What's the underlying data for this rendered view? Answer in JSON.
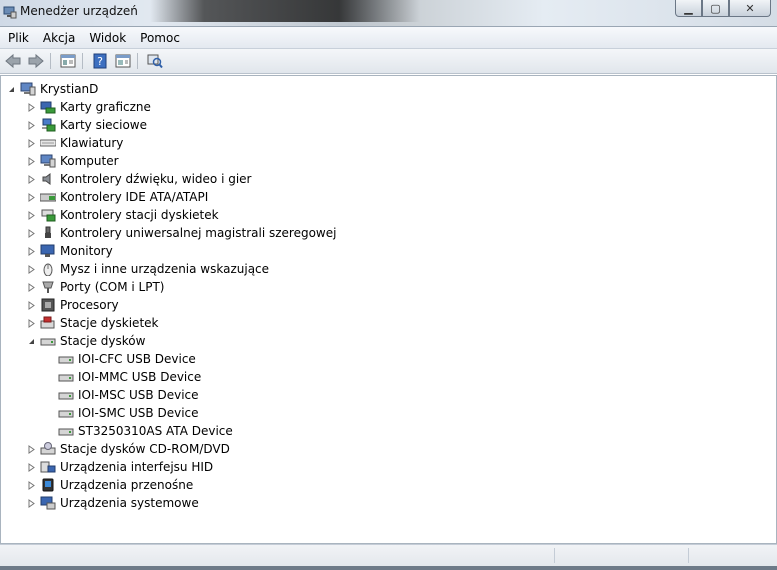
{
  "window": {
    "title": "Menedżer urządzeń"
  },
  "menu": [
    {
      "label": "Plik"
    },
    {
      "label": "Akcja"
    },
    {
      "label": "Widok"
    },
    {
      "label": "Pomoc"
    }
  ],
  "toolbar": {
    "buttons": [
      "back-arrow-icon",
      "forward-arrow-icon",
      "properties-icon",
      "help-icon",
      "view-icon",
      "scan-hardware-icon"
    ]
  },
  "tree": {
    "root": {
      "label": "KrystianD",
      "icon": "computer-icon",
      "expanded": true
    },
    "categories": [
      {
        "label": "Karty graficzne",
        "icon": "display-adapter-icon"
      },
      {
        "label": "Karty sieciowe",
        "icon": "network-adapter-icon"
      },
      {
        "label": "Klawiatury",
        "icon": "keyboard-icon"
      },
      {
        "label": "Komputer",
        "icon": "computer-icon"
      },
      {
        "label": "Kontrolery dźwięku, wideo i gier",
        "icon": "speaker-icon"
      },
      {
        "label": "Kontrolery IDE ATA/ATAPI",
        "icon": "ide-controller-icon"
      },
      {
        "label": "Kontrolery stacji dyskietek",
        "icon": "floppy-controller-icon"
      },
      {
        "label": "Kontrolery uniwersalnej magistrali szeregowej",
        "icon": "usb-icon"
      },
      {
        "label": "Monitory",
        "icon": "monitor-icon"
      },
      {
        "label": "Mysz i inne urządzenia wskazujące",
        "icon": "mouse-icon"
      },
      {
        "label": "Porty (COM i LPT)",
        "icon": "port-icon"
      },
      {
        "label": "Procesory",
        "icon": "processor-icon"
      },
      {
        "label": "Stacje dyskietek",
        "icon": "floppy-drive-icon"
      },
      {
        "label": "Stacje dysków",
        "icon": "disk-drive-icon",
        "expanded": true,
        "children": [
          {
            "label": "IOI-CFC USB Device",
            "icon": "disk-drive-icon"
          },
          {
            "label": "IOI-MMC USB Device",
            "icon": "disk-drive-icon"
          },
          {
            "label": "IOI-MSC USB Device",
            "icon": "disk-drive-icon"
          },
          {
            "label": "IOI-SMC USB Device",
            "icon": "disk-drive-icon"
          },
          {
            "label": "ST3250310AS ATA Device",
            "icon": "disk-drive-icon"
          }
        ]
      },
      {
        "label": "Stacje dysków CD-ROM/DVD",
        "icon": "cdrom-icon"
      },
      {
        "label": "Urządzenia interfejsu HID",
        "icon": "hid-icon"
      },
      {
        "label": "Urządzenia przenośne",
        "icon": "portable-device-icon"
      },
      {
        "label": "Urządzenia systemowe",
        "icon": "system-device-icon"
      }
    ]
  }
}
